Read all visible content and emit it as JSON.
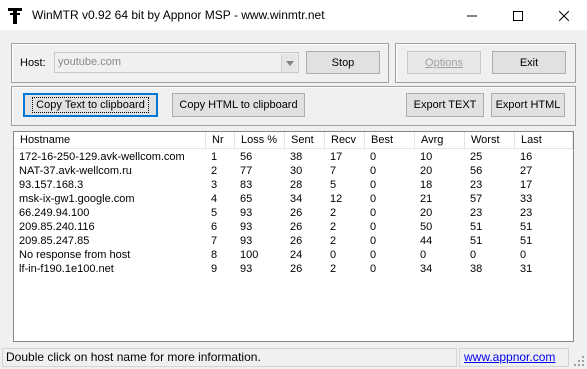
{
  "window": {
    "title": "WinMTR v0.92 64 bit by Appnor MSP - www.winmtr.net"
  },
  "host": {
    "label": "Host:",
    "value": "youtube.com",
    "stop_label": "Stop",
    "options_label": "Options",
    "exit_label": "Exit"
  },
  "actions": {
    "copy_text_label": "Copy Text to clipboard",
    "copy_html_label": "Copy HTML to clipboard",
    "export_text_label": "Export TEXT",
    "export_html_label": "Export HTML"
  },
  "table": {
    "columns": [
      "Hostname",
      "Nr",
      "Loss %",
      "Sent",
      "Recv",
      "Best",
      "Avrg",
      "Worst",
      "Last"
    ],
    "rows": [
      [
        "172-16-250-129.avk-wellcom.com",
        "1",
        "56",
        "38",
        "17",
        "0",
        "10",
        "25",
        "16"
      ],
      [
        "NAT-37.avk-wellcom.ru",
        "2",
        "77",
        "30",
        "7",
        "0",
        "20",
        "56",
        "27"
      ],
      [
        "93.157.168.3",
        "3",
        "83",
        "28",
        "5",
        "0",
        "18",
        "23",
        "17"
      ],
      [
        "msk-ix-gw1.google.com",
        "4",
        "65",
        "34",
        "12",
        "0",
        "21",
        "57",
        "33"
      ],
      [
        "66.249.94.100",
        "5",
        "93",
        "26",
        "2",
        "0",
        "20",
        "23",
        "23"
      ],
      [
        "209.85.240.116",
        "6",
        "93",
        "26",
        "2",
        "0",
        "50",
        "51",
        "51"
      ],
      [
        "209.85.247.85",
        "7",
        "93",
        "26",
        "2",
        "0",
        "44",
        "51",
        "51"
      ],
      [
        "No response from host",
        "8",
        "100",
        "24",
        "0",
        "0",
        "0",
        "0",
        "0"
      ],
      [
        "lf-in-f190.1e100.net",
        "9",
        "93",
        "26",
        "2",
        "0",
        "34",
        "38",
        "31"
      ]
    ]
  },
  "status": {
    "message": "Double click on host name for more information.",
    "link": "www.appnor.com"
  }
}
